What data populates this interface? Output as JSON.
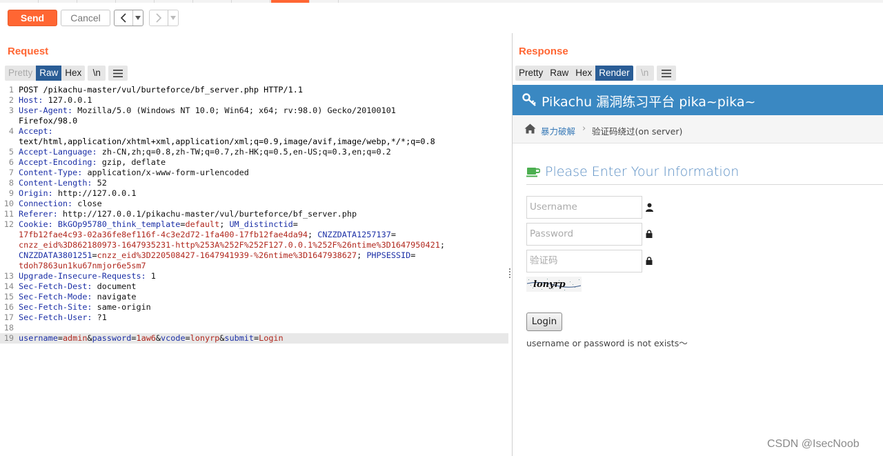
{
  "toolbar": {
    "send_label": "Send",
    "cancel_label": "Cancel",
    "back_icon": "chevron-left-icon",
    "forward_icon": "chevron-right-icon"
  },
  "colors": {
    "accent": "#ff6633",
    "selected_tab": "#2a5d96",
    "site_header": "#3a88c2"
  },
  "request": {
    "title": "Request",
    "formats": [
      "Pretty",
      "Raw",
      "Hex"
    ],
    "selected_format": "Raw",
    "newline_label": "\\n",
    "lines": [
      {
        "n": "1",
        "text": "POST /pikachu-master/vul/burteforce/bf_server.php HTTP/1.1"
      },
      {
        "n": "2",
        "key": "Host:",
        "val": " 127.0.0.1"
      },
      {
        "n": "3",
        "key": "User-Agent:",
        "val": " Mozilla/5.0 (Windows NT 10.0; Win64; x64; rv:98.0) Gecko/20100101"
      },
      {
        "n": "",
        "text": "Firefox/98.0"
      },
      {
        "n": "4",
        "key": "Accept:",
        "val": ""
      },
      {
        "n": "",
        "text": "text/html,application/xhtml+xml,application/xml;q=0.9,image/avif,image/webp,*/*;q=0.8"
      },
      {
        "n": "5",
        "key": "Accept-Language:",
        "val": " zh-CN,zh;q=0.8,zh-TW;q=0.7,zh-HK;q=0.5,en-US;q=0.3,en;q=0.2"
      },
      {
        "n": "6",
        "key": "Accept-Encoding:",
        "val": " gzip, deflate"
      },
      {
        "n": "7",
        "key": "Content-Type:",
        "val": " application/x-www-form-urlencoded"
      },
      {
        "n": "8",
        "key": "Content-Length:",
        "val": " 52"
      },
      {
        "n": "9",
        "key": "Origin:",
        "val": " http://127.0.0.1"
      },
      {
        "n": "10",
        "key": "Connection:",
        "val": " close"
      },
      {
        "n": "11",
        "key": "Referer:",
        "val": " http://127.0.0.1/pikachu-master/vul/burteforce/bf_server.php"
      },
      {
        "n": "12",
        "cookie": true,
        "parts": [
          {
            "c": "hk",
            "t": "Cookie:"
          },
          {
            "c": "op",
            "t": " "
          },
          {
            "c": "ck",
            "t": "BkGOp95780_think_template"
          },
          {
            "c": "op",
            "t": "="
          },
          {
            "c": "cv",
            "t": "default"
          },
          {
            "c": "op",
            "t": "; "
          },
          {
            "c": "ck",
            "t": "UM_distinctid"
          },
          {
            "c": "op",
            "t": "="
          }
        ]
      },
      {
        "n": "",
        "cookie": true,
        "parts": [
          {
            "c": "cv",
            "t": "17fb12fae4c93-02a36fe8ef116f-4c3e2d72-1fa400-17fb12fae4da94"
          },
          {
            "c": "op",
            "t": "; "
          },
          {
            "c": "ck",
            "t": "CNZZDATA1257137"
          },
          {
            "c": "op",
            "t": "="
          }
        ]
      },
      {
        "n": "",
        "cookie": true,
        "parts": [
          {
            "c": "cv",
            "t": "cnzz_eid%3D862180973-1647935231-http%253A%252F%252F127.0.0.1%252F%26ntime%3D1647950421"
          },
          {
            "c": "op",
            "t": ";"
          }
        ]
      },
      {
        "n": "",
        "cookie": true,
        "parts": [
          {
            "c": "ck",
            "t": "CNZZDATA3801251"
          },
          {
            "c": "op",
            "t": "="
          },
          {
            "c": "cv",
            "t": "cnzz_eid%3D220508427-1647941939-%26ntime%3D1647938627"
          },
          {
            "c": "op",
            "t": "; "
          },
          {
            "c": "ck",
            "t": "PHPSESSID"
          },
          {
            "c": "op",
            "t": "="
          }
        ]
      },
      {
        "n": "",
        "cookie": true,
        "parts": [
          {
            "c": "cv",
            "t": "tdoh7863un1ku67nmjor6e5sm7"
          }
        ]
      },
      {
        "n": "13",
        "key": "Upgrade-Insecure-Requests:",
        "val": " 1"
      },
      {
        "n": "14",
        "key": "Sec-Fetch-Dest:",
        "val": " document"
      },
      {
        "n": "15",
        "key": "Sec-Fetch-Mode:",
        "val": " navigate"
      },
      {
        "n": "16",
        "key": "Sec-Fetch-Site:",
        "val": " same-origin"
      },
      {
        "n": "17",
        "key": "Sec-Fetch-User:",
        "val": " ?1"
      },
      {
        "n": "18",
        "text": ""
      },
      {
        "n": "19",
        "body": true,
        "parts": [
          {
            "c": "pk",
            "t": "username"
          },
          {
            "c": "op",
            "t": "="
          },
          {
            "c": "pv",
            "t": "admin"
          },
          {
            "c": "op",
            "t": "&"
          },
          {
            "c": "pk",
            "t": "password"
          },
          {
            "c": "op",
            "t": "="
          },
          {
            "c": "pv",
            "t": "1aw6"
          },
          {
            "c": "op",
            "t": "&"
          },
          {
            "c": "pk",
            "t": "vcode"
          },
          {
            "c": "op",
            "t": "="
          },
          {
            "c": "pv",
            "t": "lonyrp"
          },
          {
            "c": "op",
            "t": "&"
          },
          {
            "c": "pk",
            "t": "submit"
          },
          {
            "c": "op",
            "t": "="
          },
          {
            "c": "pv",
            "t": "Login"
          }
        ]
      }
    ]
  },
  "response": {
    "title": "Response",
    "formats": [
      "Pretty",
      "Raw",
      "Hex",
      "Render"
    ],
    "selected_format": "Render",
    "newline_label": "\\n",
    "render": {
      "site_title": "Pikachu 漏洞练习平台 pika~pika~",
      "breadcrumb_1": "暴力破解",
      "breadcrumb_sep": "›",
      "breadcrumb_2": "验证码绕过(on server)",
      "form_title": "Please Enter Your Information",
      "username_placeholder": "Username",
      "password_placeholder": "Password",
      "vcode_placeholder": "验证码",
      "captcha_text": "lonyrp",
      "login_label": "Login",
      "message": "username or password is not exists～"
    }
  },
  "watermark": "CSDN @IsecNoob"
}
